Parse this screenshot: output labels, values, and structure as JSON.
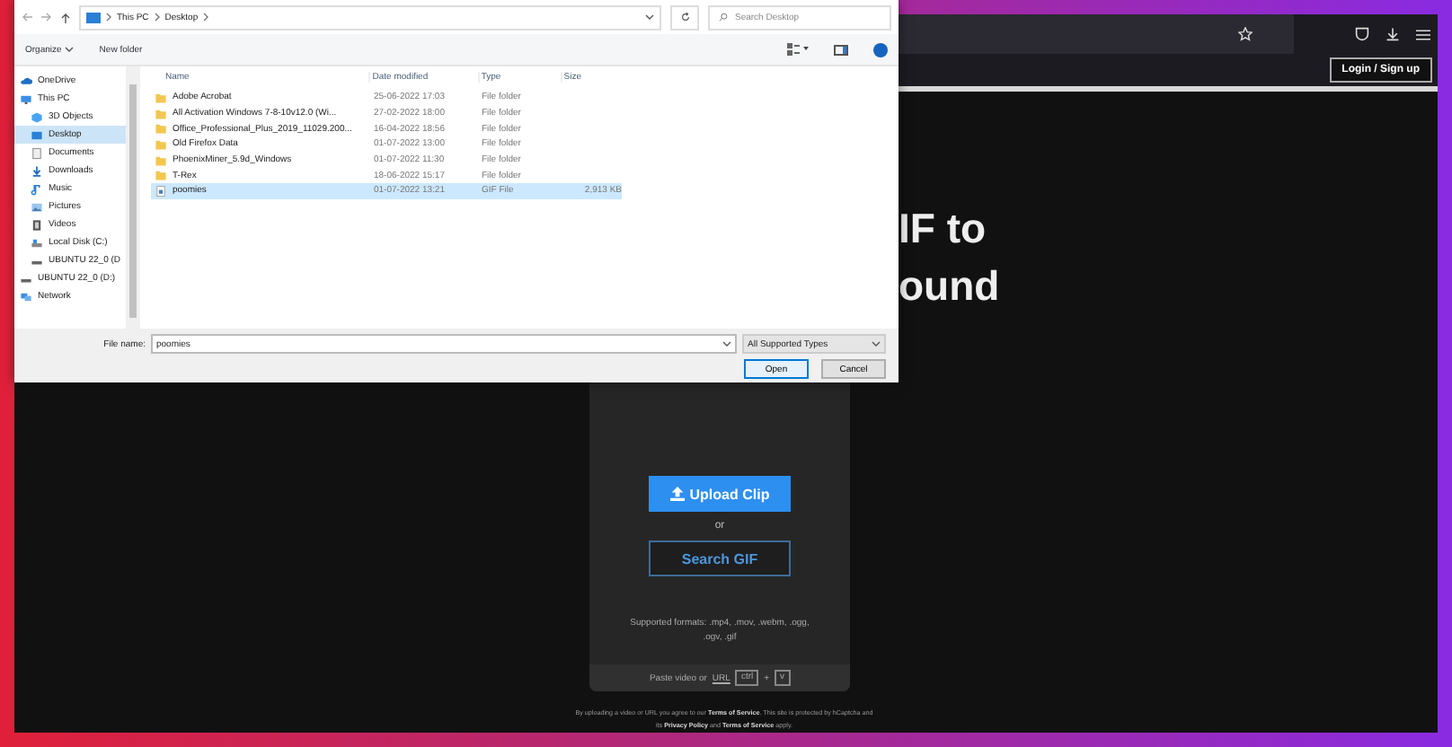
{
  "dialog": {
    "nav": {
      "path": [
        "This PC",
        "Desktop"
      ],
      "search": {
        "placeholder": "Search Desktop"
      }
    },
    "toolbar": {
      "organize": "Organize",
      "new_folder": "New folder"
    },
    "sidebar": [
      {
        "label": "OneDrive",
        "kind": "cloud",
        "selected": false
      },
      {
        "label": "This PC",
        "kind": "pc",
        "selected": false,
        "children": [
          {
            "label": "3D Objects",
            "kind": "cube",
            "selected": false
          },
          {
            "label": "Desktop",
            "kind": "desktop",
            "selected": true
          },
          {
            "label": "Documents",
            "kind": "doc",
            "selected": false
          },
          {
            "label": "Downloads",
            "kind": "download",
            "selected": false
          },
          {
            "label": "Music",
            "kind": "music",
            "selected": false
          },
          {
            "label": "Pictures",
            "kind": "pictures",
            "selected": false
          },
          {
            "label": "Videos",
            "kind": "videos",
            "selected": false
          },
          {
            "label": "Local Disk (C:)",
            "kind": "disk",
            "selected": false
          },
          {
            "label": "UBUNTU 22_0 (D",
            "kind": "drive",
            "selected": false
          }
        ]
      },
      {
        "label": "UBUNTU 22_0 (D:)",
        "kind": "drive",
        "selected": false
      },
      {
        "label": "Network",
        "kind": "network",
        "selected": false
      }
    ],
    "columns": [
      "Name",
      "Date modified",
      "Type",
      "Size"
    ],
    "rows": [
      {
        "kind": "folder",
        "name": "Adobe Acrobat",
        "date": "25-06-2022 17:03",
        "type": "File folder",
        "size": "",
        "selected": false
      },
      {
        "kind": "folder",
        "name": "All Activation Windows 7-8-10v12.0 (Wi...",
        "date": "27-02-2022 18:00",
        "type": "File folder",
        "size": "",
        "selected": false
      },
      {
        "kind": "folder",
        "name": "Office_Professional_Plus_2019_11029.200...",
        "date": "16-04-2022 18:56",
        "type": "File folder",
        "size": "",
        "selected": false
      },
      {
        "kind": "folder",
        "name": "Old Firefox Data",
        "date": "01-07-2022 13:00",
        "type": "File folder",
        "size": "",
        "selected": false
      },
      {
        "kind": "folder",
        "name": "PhoenixMiner_5.9d_Windows",
        "date": "01-07-2022 11:30",
        "type": "File folder",
        "size": "",
        "selected": false
      },
      {
        "kind": "folder",
        "name": "T-Rex",
        "date": "18-06-2022 15:17",
        "type": "File folder",
        "size": "",
        "selected": false
      },
      {
        "kind": "gif",
        "name": "poomies",
        "date": "01-07-2022 13:21",
        "type": "GIF File",
        "size": "2,913 KB",
        "selected": true
      }
    ],
    "file_name": {
      "label": "File name:",
      "value": "poomies"
    },
    "file_type": "All Supported Types",
    "buttons": [
      {
        "label": "Open",
        "primary": true
      },
      {
        "label": "Cancel",
        "primary": false
      }
    ]
  },
  "page": {
    "login": "Login / Sign up",
    "headline": [
      "IF to",
      "ound"
    ],
    "upload": "Upload Clip",
    "or": "or",
    "search_gif": "Search GIF",
    "formats": "Supported formats: .mp4, .mov, .webm, .ogg, .ogv, .gif",
    "paste": {
      "text": "Paste video or",
      "link": "URL",
      "keys": [
        "ctrl",
        "+",
        "v"
      ]
    },
    "footer": "By uploading a video or URL you agree to our **Terms of Service**. This site is protected by hCaptcha and its **Privacy Policy** and **Terms of Service** apply."
  }
}
